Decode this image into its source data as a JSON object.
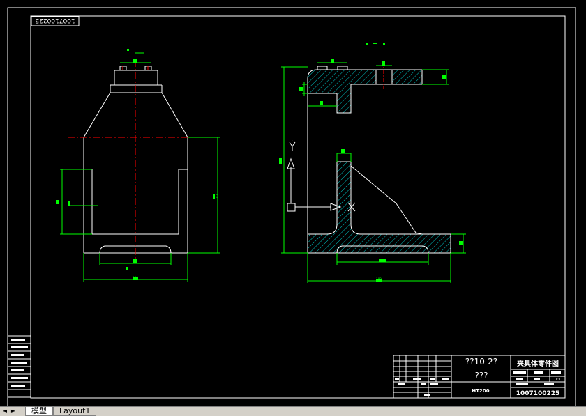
{
  "drawing": {
    "part_number_top": "1007100225",
    "top_annotation": "- -",
    "title_block": {
      "name_line1": "??10-2?",
      "name_line2": "???",
      "material": "HT200",
      "drawing_title": "夹具体零件图",
      "scale": "1:1",
      "drawing_number": "1007100225"
    },
    "dimensions": {
      "left_width": "180",
      "left_height": "120",
      "left_bottom": "88",
      "right_width": "180",
      "right_bottom_slot": "98.4"
    },
    "ucs": {
      "y_label": "Y",
      "x_label": "X"
    }
  },
  "tabs": {
    "nav_first": "◄",
    "nav_next": "►",
    "model": "模型",
    "layout1": "Layout1"
  },
  "colors": {
    "background": "#000000",
    "frame": "#ffffff",
    "dimension": "#00ff00",
    "centerline": "#ff0000",
    "hatch": "#00c8c8"
  }
}
